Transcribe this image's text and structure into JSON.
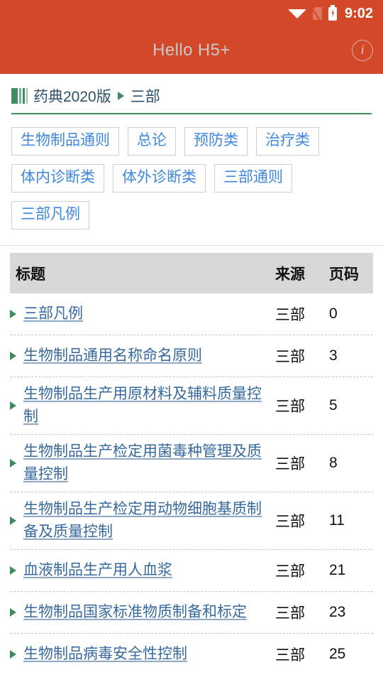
{
  "statusbar": {
    "time": "9:02",
    "icons": [
      "wifi-icon",
      "no-sim-icon",
      "battery-charging-icon"
    ]
  },
  "appbar": {
    "title": "Hello H5+",
    "info_icon": "info-icon",
    "bg_color": "#d4482a",
    "title_color": "#c9c9c9"
  },
  "breadcrumb": {
    "icon": "books-icon",
    "root": "药典2020版",
    "separator": "▶",
    "current": "三部",
    "underline_color": "#3f8a5f"
  },
  "tags": {
    "accent_color": "#3d87df",
    "items": [
      "生物制品通则",
      "总论",
      "预防类",
      "治疗类",
      "体内诊断类",
      "体外诊断类",
      "三部通则",
      "三部凡例"
    ]
  },
  "table": {
    "headers": {
      "title": "标题",
      "source": "来源",
      "page": "页码"
    },
    "rows": [
      {
        "title": "三部凡例",
        "source": "三部",
        "page": "0"
      },
      {
        "title": "生物制品通用名称命名原则",
        "source": "三部",
        "page": "3"
      },
      {
        "title": "生物制品生产用原材料及辅料质量控制",
        "source": "三部",
        "page": "5"
      },
      {
        "title": "生物制品生产检定用菌毒种管理及质量控制",
        "source": "三部",
        "page": "8"
      },
      {
        "title": "生物制品生产检定用动物细胞基质制备及质量控制",
        "source": "三部",
        "page": "11"
      },
      {
        "title": "血液制品生产用人血浆",
        "source": "三部",
        "page": "21"
      },
      {
        "title": "生物制品国家标准物质制备和标定",
        "source": "三部",
        "page": "23"
      },
      {
        "title": "生物制品病毒安全性控制",
        "source": "三部",
        "page": "25"
      }
    ]
  }
}
